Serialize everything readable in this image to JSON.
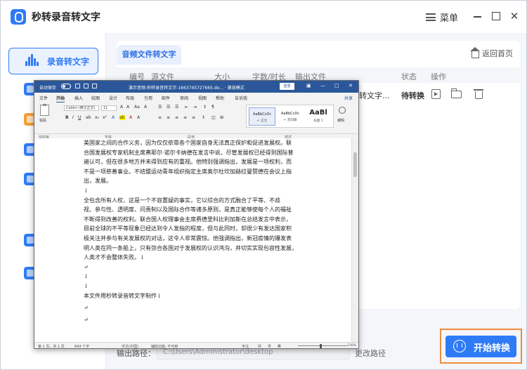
{
  "app": {
    "title": "秒转录音转文字",
    "menu_label": "菜单",
    "colors": {
      "accent": "#2f7bf6",
      "highlight_border": "#ef8b3e"
    }
  },
  "sidebar": {
    "active_item": {
      "label": "录音转文字",
      "icon": "audio-wave-icon"
    },
    "items": [
      {
        "icon": "video-icon",
        "color": "#2f7bf6"
      },
      {
        "icon": "document-icon",
        "color": "#f59f36"
      },
      {
        "icon": "video-play-icon",
        "color": "#2f7bf6"
      },
      {
        "icon": "audio-icon",
        "color": "#2f7bf6"
      },
      {
        "icon": "translate-icon",
        "color": "#2f7bf6"
      },
      {
        "icon": "text-file-icon",
        "color": "#2f7bf6"
      }
    ]
  },
  "main": {
    "tab_label": "音频文件转文字",
    "back_home": "返回首页",
    "columns": [
      "编号",
      "源文件",
      "大小",
      "字数/时长",
      "输出文件",
      "状态",
      "操作"
    ],
    "rows": [
      {
        "output_file": "转文字...",
        "status": "待转换"
      }
    ]
  },
  "footer": {
    "output_label": "输出路径：",
    "output_path": "C:\\Users\\Administrator\\desktop",
    "change_path": "更改路径",
    "start_button": "开始转换"
  },
  "word": {
    "autosave": "自动保存",
    "doc_title": "演示音频-秒转录音转文字-1663745727665.do... · 兼容模式",
    "login": "登录",
    "share": "共享",
    "menus": [
      "文件",
      "开始",
      "插入",
      "绘图",
      "设计",
      "布局",
      "引用",
      "邮件",
      "审阅",
      "视图",
      "帮助",
      "告诉我"
    ],
    "ribbon": {
      "paste": "粘贴",
      "clipboard": "剪贴板",
      "font_name": "Calibri (西文正文)",
      "font_size": "11",
      "font_group": "字体",
      "paragraph_group": "段落",
      "styles_group": "样式",
      "styles": [
        {
          "preview": "AaBbCcDc",
          "name": "↵ 正文"
        },
        {
          "preview": "AaBbCcDc",
          "name": "↵ 无间隔"
        },
        {
          "preview": "AaBl",
          "name": "标题 1"
        }
      ],
      "edit": "编辑"
    },
    "body_lines": [
      "美国家之间的合作义务，因为仅仅依靠各个国家自身无法真正保护和促进发展权。联",
      "合国发展权专家机制主席弗耶尔·诺尔卡纳德在发言中说，尽管发展权已经得到国际普",
      "遍认可，但在很多地方并未得到应有的重视。他特别强调指出，发展是一项权利，而",
      "不是一项慈善事业。不结盟运动青年组织指定主席奥尔杜坎加赫拉曼赞德在会议上指",
      "出，发展。",
      "↓",
      "全包含所有人权，这是一个不容置疑的事实，它以综合的方式融合了平等、不歧",
      "视、参与性、透明度、问责制以及国际合作等诸多原则，是真正能够使每个人的福祉",
      "不断得到改善的权利。联合国人权理事会主席费德里科比利加斯在总结发言中表示，",
      "目前全球的不平等现象已经达到令人发指的程度，但与此同时，却很少有发达国家积",
      "极关注并参与有关发展权的对话，这令人非常震惊。他强调指出，新冠疫情的爆发表",
      "明人类在同一条船上，只有弥合各国对于发展权的认识鸿沟，并切实实现包容性发展，",
      "人类才不会整体失败。↓",
      "↵",
      "↓",
      "↓",
      "本文件用秒转录音转文字制作↓",
      "↵",
      "↵"
    ],
    "status": {
      "page": "第 1 页，共 1 页",
      "words": "844 个字",
      "lang": "中文(中国)",
      "assist": "辅助功能: 不可用",
      "focus": "专注",
      "zoom": "130%"
    }
  }
}
